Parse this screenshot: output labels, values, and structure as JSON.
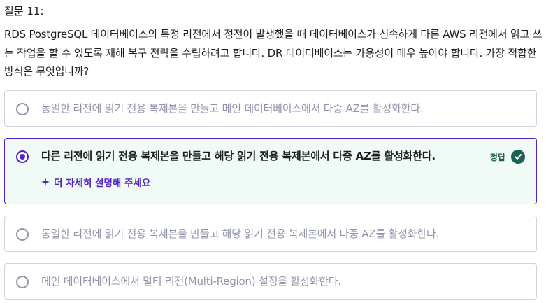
{
  "question": {
    "label": "질문 11:",
    "text": "RDS PostgreSQL 데이터베이스의 특정 리전에서 정전이 발생했을 때 데이터베이스가 신속하게 다른 AWS 리전에서 읽고 쓰는 작업을 할 수 있도록 재해 복구 전략을 수립하려고 합니다. DR 데이터베이스는 가용성이 매우 높아야 합니다. 가장 적합한 방식은 무엇입니까?"
  },
  "options": [
    {
      "label": "동일한 리전에 읽기 전용 복제본을 만들고 메인 데이터베이스에서 다중 AZ를 활성화한다.",
      "selected": false
    },
    {
      "label": "다른 리전에 읽기 전용 복제본을 만들고 해당 읽기 전용 복제본에서 다중 AZ를 활성화한다.",
      "selected": true,
      "correct_label": "정답",
      "explain_label": "더 자세히 설명해 주세요"
    },
    {
      "label": "동일한 리전에 읽기 전용 복제본을 만들고 해당 읽기 전용 복제본에서 다중 AZ를 활성화한다.",
      "selected": false
    },
    {
      "label": "메인 데이터베이스에서 멀티 리전(Multi-Region) 설정을 활성화한다.",
      "selected": false
    }
  ],
  "colors": {
    "accent": "#5022c3",
    "correct": "#1e6055",
    "selected_bg": "#f0fbf7",
    "border": "#d1d2e0",
    "muted_text": "#9194ac"
  },
  "icons": {
    "radio": "radio-button-icon",
    "check": "check-circle-icon",
    "sparkle": "sparkle-icon"
  }
}
